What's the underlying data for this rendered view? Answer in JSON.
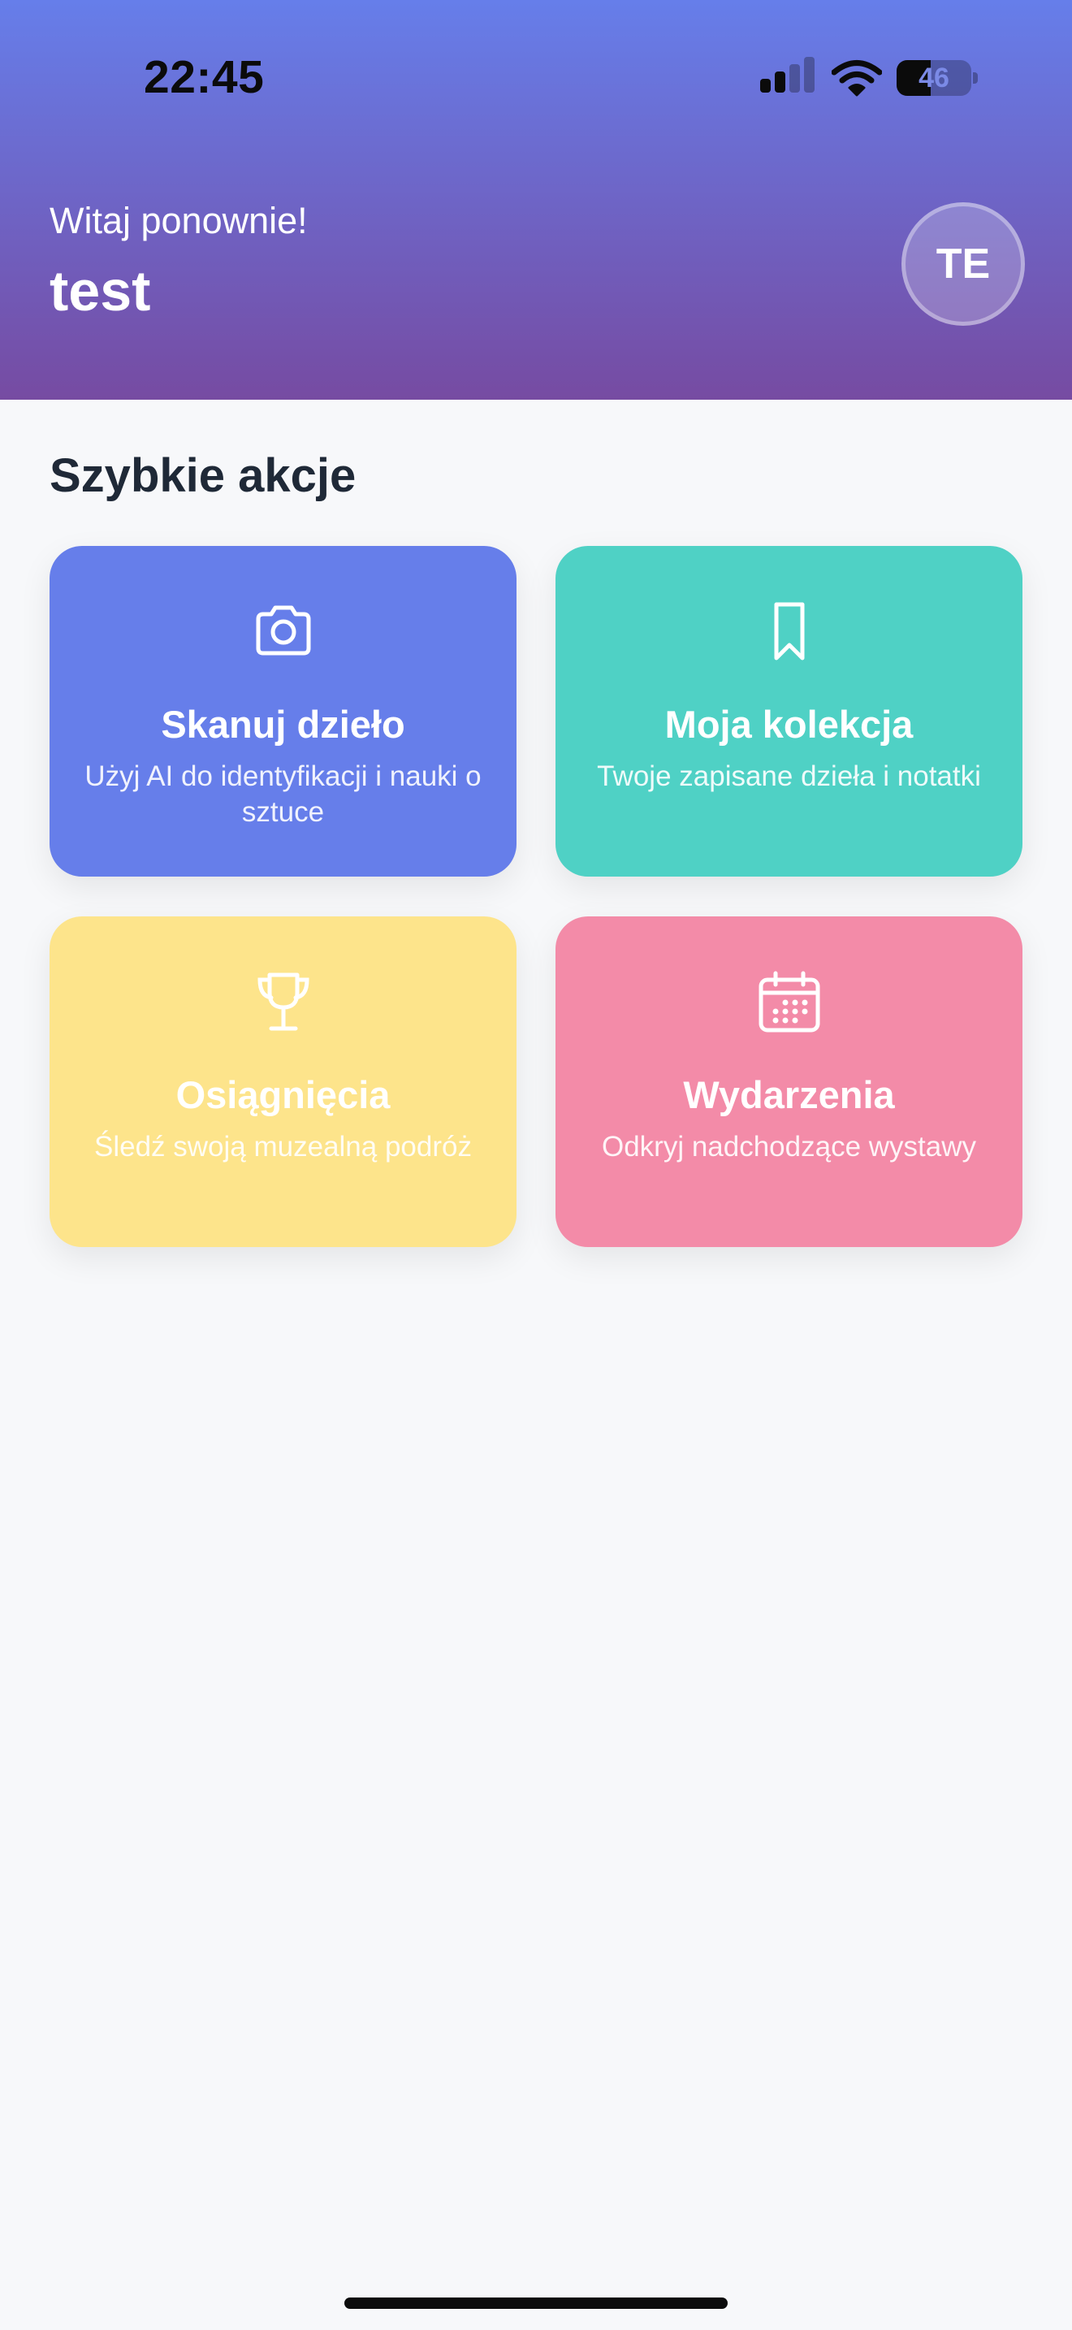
{
  "status_bar": {
    "time": "22:45",
    "battery": "46",
    "battery_level": 0.46,
    "signal_bars_active": 2,
    "icons": [
      "signal-icon",
      "wifi-icon",
      "battery-icon"
    ]
  },
  "header": {
    "greeting": "Witaj ponownie!",
    "username": "test",
    "avatar_initials": "TE"
  },
  "quick_actions": {
    "title": "Szybkie akcje",
    "items": [
      {
        "title": "Skanuj dzieło",
        "subtitle": "Użyj AI do identyfikacji i nauki o sztuce",
        "icon": "camera-icon",
        "color": "#667eea"
      },
      {
        "title": "Moja kolekcja",
        "subtitle": "Twoje zapisane dzieła i notatki",
        "icon": "bookmark-icon",
        "color": "#4fd1c5"
      },
      {
        "title": "Osiągnięcia",
        "subtitle": "Śledź swoją muzealną podróż",
        "icon": "trophy-icon",
        "color": "#fde48b"
      },
      {
        "title": "Wydarzenia",
        "subtitle": "Odkryj nadchodzące wystawy",
        "icon": "calendar-icon",
        "color": "#f38ba8"
      }
    ]
  },
  "colors": {
    "header_gradient_start": "#667eea",
    "header_gradient_end": "#764ba2",
    "background": "#f7f8fa"
  }
}
